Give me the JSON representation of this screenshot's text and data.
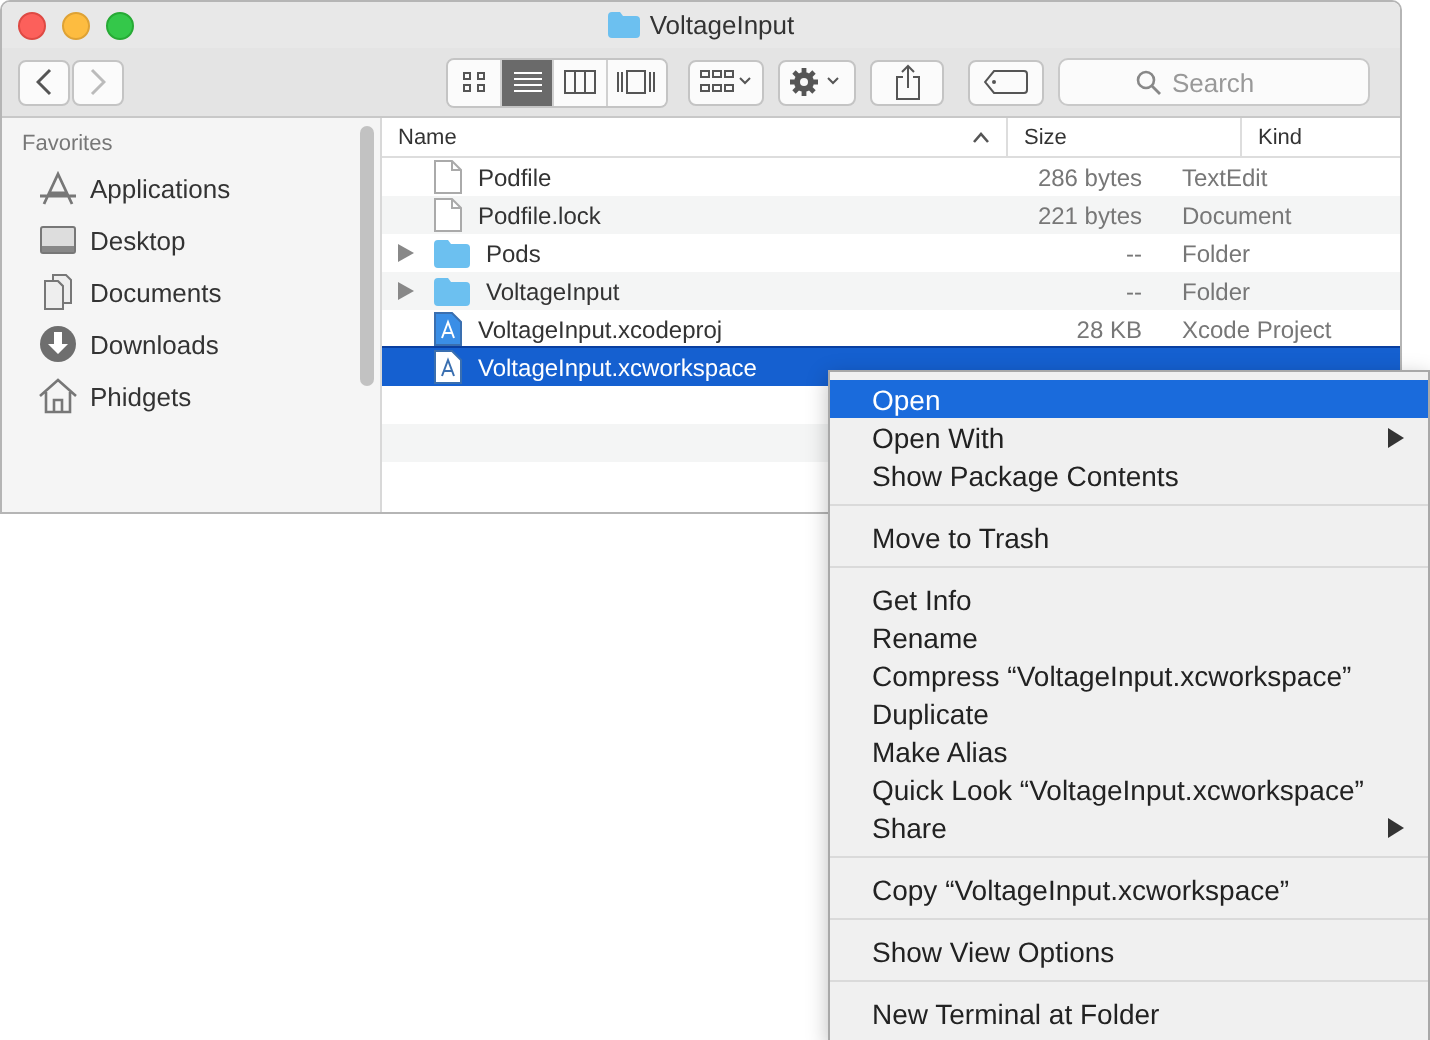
{
  "window": {
    "title": "VoltageInput"
  },
  "toolbar": {
    "back": {
      "disabled": false
    },
    "forward": {
      "disabled": true
    },
    "view_modes": [
      {
        "kind": "icons",
        "selected": false
      },
      {
        "kind": "list",
        "selected": true
      },
      {
        "kind": "columns",
        "selected": false
      },
      {
        "kind": "gallery",
        "selected": false
      }
    ],
    "search": {
      "placeholder": "Search"
    }
  },
  "sidebar": {
    "section": "Favorites",
    "items": [
      {
        "label": "Applications",
        "kind": "applications"
      },
      {
        "label": "Desktop",
        "kind": "desktop"
      },
      {
        "label": "Documents",
        "kind": "documents"
      },
      {
        "label": "Downloads",
        "kind": "downloads"
      },
      {
        "label": "Phidgets",
        "kind": "home"
      }
    ]
  },
  "table": {
    "columns": [
      {
        "label": "Name",
        "sorted": true
      },
      {
        "label": "Size",
        "sorted": false
      },
      {
        "label": "Kind",
        "sorted": false
      }
    ],
    "rows": [
      {
        "name": "Podfile",
        "size": "286 bytes",
        "file_kind": "TextEdit",
        "kind": "document",
        "expandable": false,
        "selected": false
      },
      {
        "name": "Podfile.lock",
        "size": "221 bytes",
        "file_kind": "Document",
        "kind": "document",
        "expandable": false,
        "selected": false
      },
      {
        "name": "Pods",
        "size": "--",
        "file_kind": "Folder",
        "kind": "folder",
        "expandable": true,
        "selected": false
      },
      {
        "name": "VoltageInput",
        "size": "--",
        "file_kind": "Folder",
        "kind": "folder",
        "expandable": true,
        "selected": false
      },
      {
        "name": "VoltageInput.xcodeproj",
        "size": "28 KB",
        "file_kind": "Xcode Project",
        "kind": "project",
        "expandable": false,
        "selected": false
      },
      {
        "name": "VoltageInput.xcworkspace",
        "kind": "workspace",
        "expandable": false,
        "selected": true
      }
    ]
  },
  "context_menu": {
    "items": [
      {
        "kind": "item",
        "label": "Open",
        "selected": true,
        "submenu": false
      },
      {
        "kind": "item",
        "label": "Open With",
        "selected": false,
        "submenu": true
      },
      {
        "kind": "item",
        "label": "Show Package Contents",
        "selected": false,
        "submenu": false
      },
      {
        "kind": "separator"
      },
      {
        "kind": "item",
        "label": "Move to Trash",
        "selected": false,
        "submenu": false
      },
      {
        "kind": "separator"
      },
      {
        "kind": "item",
        "label": "Get Info",
        "selected": false,
        "submenu": false
      },
      {
        "kind": "item",
        "label": "Rename",
        "selected": false,
        "submenu": false
      },
      {
        "kind": "item",
        "label": "Compress “VoltageInput.xcworkspace”",
        "selected": false,
        "submenu": false
      },
      {
        "kind": "item",
        "label": "Duplicate",
        "selected": false,
        "submenu": false
      },
      {
        "kind": "item",
        "label": "Make Alias",
        "selected": false,
        "submenu": false
      },
      {
        "kind": "item",
        "label": "Quick Look “VoltageInput.xcworkspace”",
        "selected": false,
        "submenu": false
      },
      {
        "kind": "item",
        "label": "Share",
        "selected": false,
        "submenu": true
      },
      {
        "kind": "separator"
      },
      {
        "kind": "item",
        "label": "Copy “VoltageInput.xcworkspace”",
        "selected": false,
        "submenu": false
      },
      {
        "kind": "separator"
      },
      {
        "kind": "item",
        "label": "Show View Options",
        "selected": false,
        "submenu": false
      },
      {
        "kind": "separator"
      },
      {
        "kind": "item",
        "label": "New Terminal at Folder",
        "selected": false,
        "submenu": false
      }
    ]
  }
}
